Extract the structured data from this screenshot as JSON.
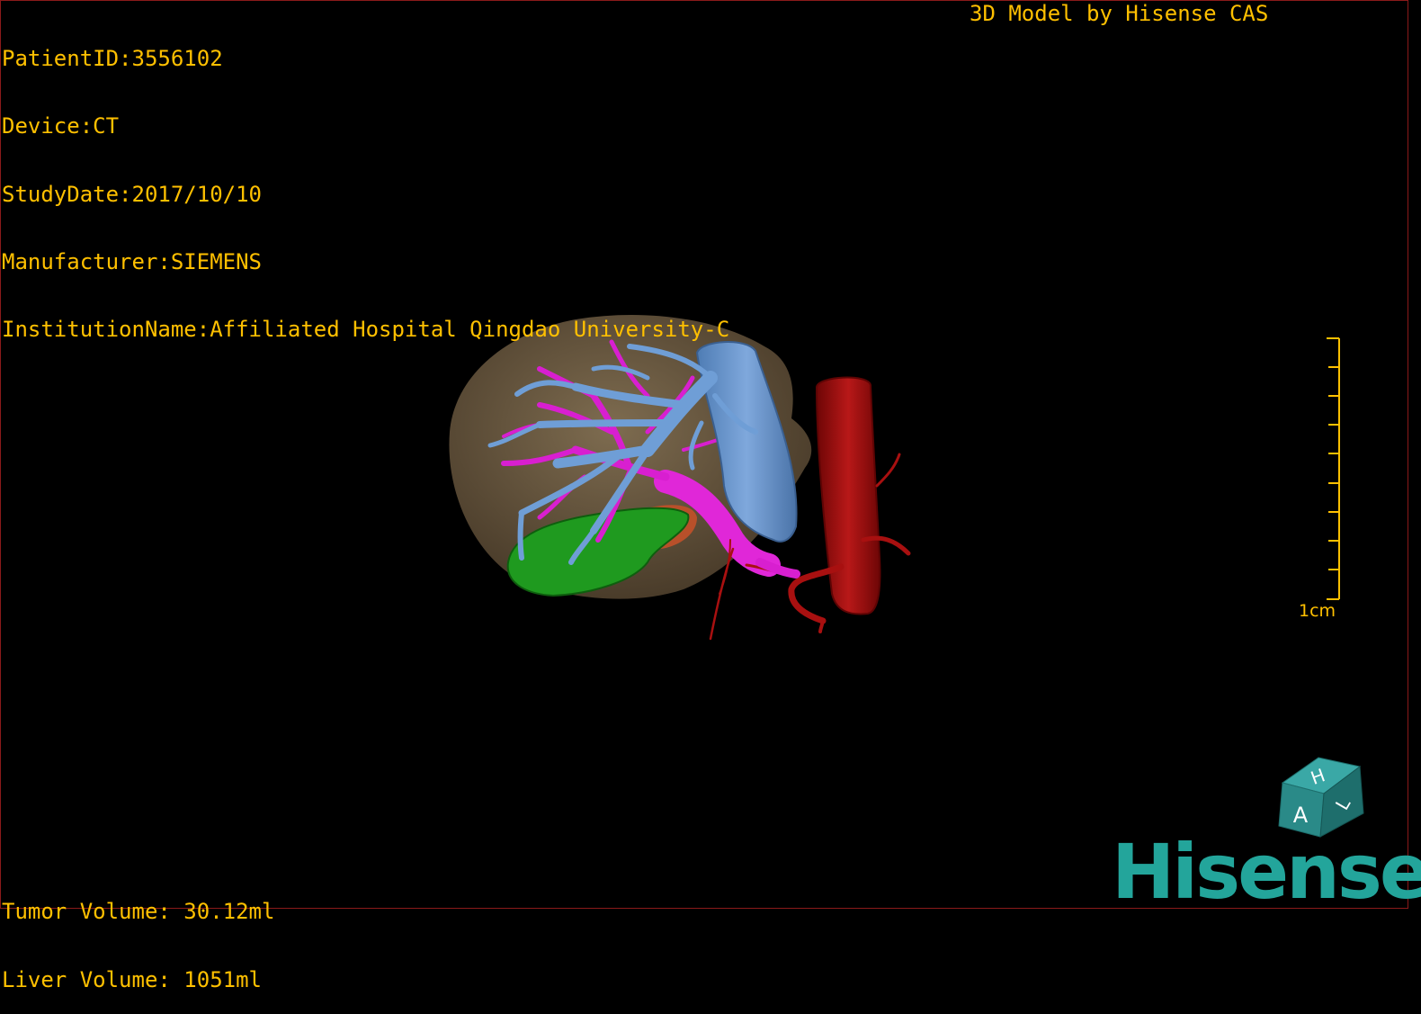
{
  "viewer": {
    "patient_id": "PatientID:3556102",
    "device": "Device:CT",
    "study_date": "StudyDate:2017/10/10",
    "manufacturer": "Manufacturer:SIEMENS",
    "institution": "InstitutionName:Affiliated Hospital Qingdao University-C",
    "model_credit": "3D Model by Hisense CAS",
    "tumor_volume": "Tumor Volume: 30.12ml",
    "liver_volume": "Liver Volume: 1051ml",
    "scale_label": "1cm",
    "logo_text": "Hisense",
    "orientation": {
      "top": "H",
      "front": "A",
      "side": "L"
    }
  },
  "colors": {
    "overlay_text": "#ffc000",
    "frame": "#8b1a1a",
    "liver": "#6b5a42",
    "portal_vein": "#e027d8",
    "hepatic_vein": "#6f9ed6",
    "tumor": "#1f9a1f",
    "aorta": "#a81010",
    "logo": "#23a59b"
  }
}
